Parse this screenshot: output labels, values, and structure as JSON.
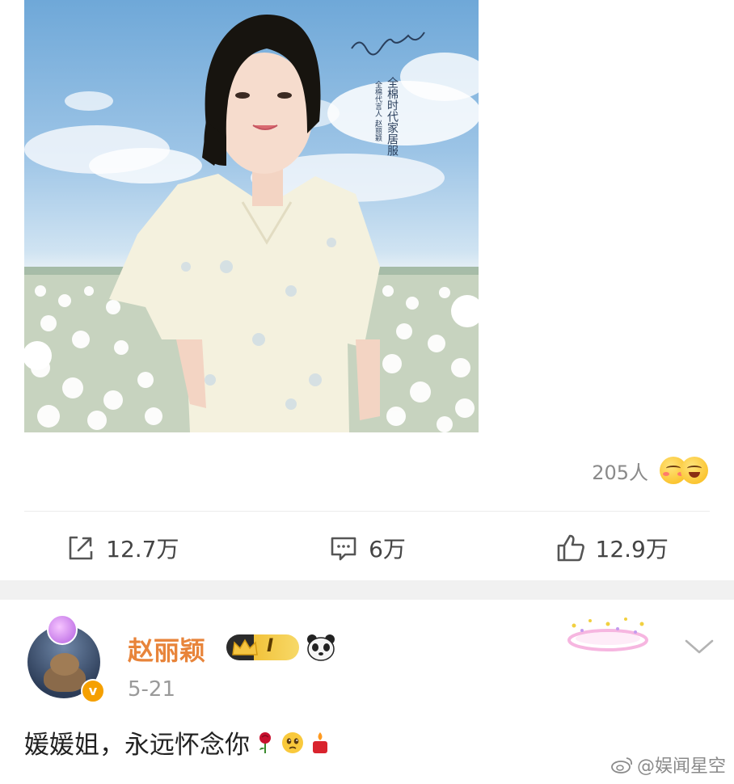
{
  "post": {
    "image": {
      "alt_label": "product-photo",
      "signature": "赵丽颖",
      "poster_text_line1": "全棉时代家居服",
      "poster_text_line2": "全棉代言人 赵丽颖"
    },
    "reactions": {
      "count": "205人",
      "emoji_names": [
        "blush-emoji",
        "grin-emoji"
      ]
    },
    "actions": {
      "repost": {
        "count": "12.7万",
        "icon": "repost-icon"
      },
      "comment": {
        "count": "6万",
        "icon": "comment-icon"
      },
      "like": {
        "count": "12.9万",
        "icon": "like-icon"
      }
    }
  },
  "comment": {
    "username": "赵丽颖",
    "badge_rank": "I",
    "date": "5-21",
    "text": "媛媛姐，永远怀念你",
    "trailing_emojis": [
      "rose-icon",
      "sad-face-emoji",
      "candle-icon"
    ],
    "verified_mark": "v"
  },
  "watermark": {
    "text": "@娱闻星空",
    "icon": "weibo-icon"
  },
  "colors": {
    "username": "#e8843a",
    "verified": "#f5a000",
    "secondary_text": "#9a9a9a",
    "section_gap": "#f1f1f1"
  }
}
